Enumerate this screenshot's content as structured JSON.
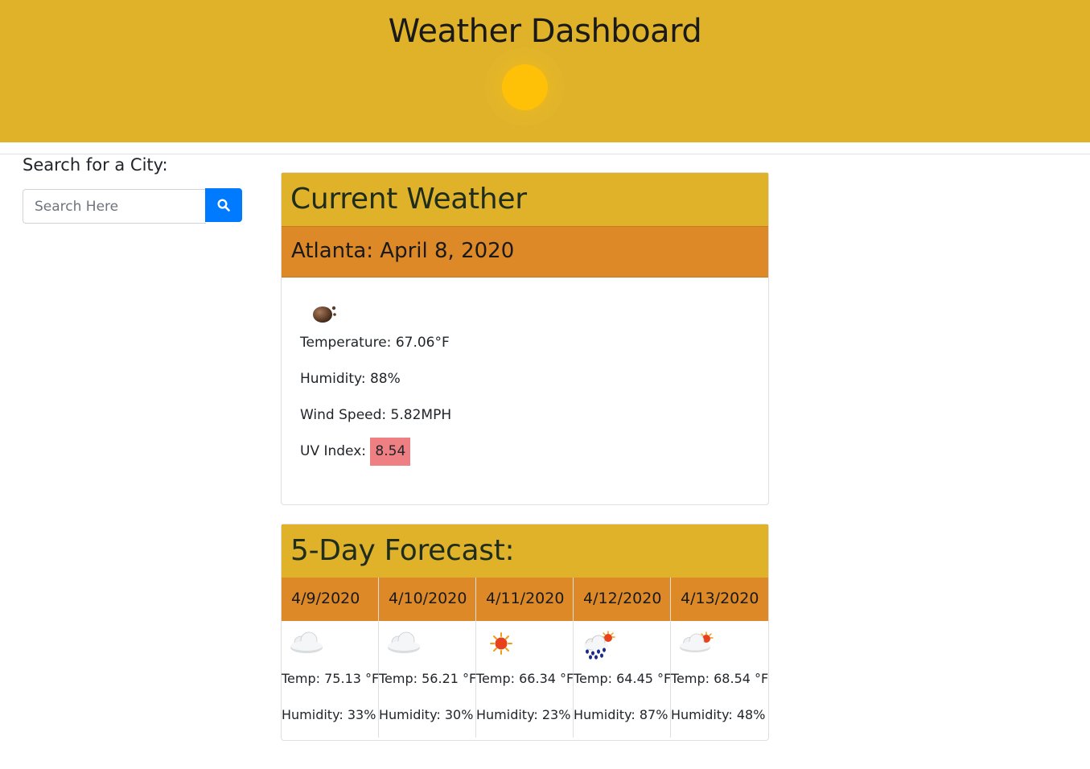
{
  "header": {
    "title": "Weather Dashboard",
    "sun_color": "#ffc107",
    "background": "#dfb22a"
  },
  "search": {
    "label": "Search for a City:",
    "placeholder": "Search Here",
    "button_icon": "search-icon",
    "button_color": "#007bff"
  },
  "current": {
    "heading": "Current Weather",
    "city_date": "Atlanta: April 8, 2020",
    "icon": "mist-icon",
    "temperature": "Temperature: 67.06°F",
    "humidity": "Humidity: 88%",
    "wind": "Wind Speed: 5.82MPH",
    "uv_label": "UV Index:",
    "uv_value": "8.54",
    "uv_color": "#ee7f82"
  },
  "forecast": {
    "heading": "5-Day Forecast:",
    "days": [
      {
        "date": "4/9/2020",
        "icon": "cloud-icon",
        "temp": "Temp: 75.13 °F",
        "humidity": "Humidity: 33%"
      },
      {
        "date": "4/10/2020",
        "icon": "cloud-icon",
        "temp": "Temp: 56.21 °F",
        "humidity": "Humidity: 30%"
      },
      {
        "date": "4/11/2020",
        "icon": "sun-icon",
        "temp": "Temp: 66.34 °F",
        "humidity": "Humidity: 23%"
      },
      {
        "date": "4/12/2020",
        "icon": "rain-sun-icon",
        "temp": "Temp: 64.45 °F",
        "humidity": "Humidity: 87%"
      },
      {
        "date": "4/13/2020",
        "icon": "cloud-sun-icon",
        "temp": "Temp: 68.54 °F",
        "humidity": "Humidity: 48%"
      }
    ]
  },
  "colors": {
    "accent_yellow": "#dfb22a",
    "accent_orange": "#dd8928"
  }
}
